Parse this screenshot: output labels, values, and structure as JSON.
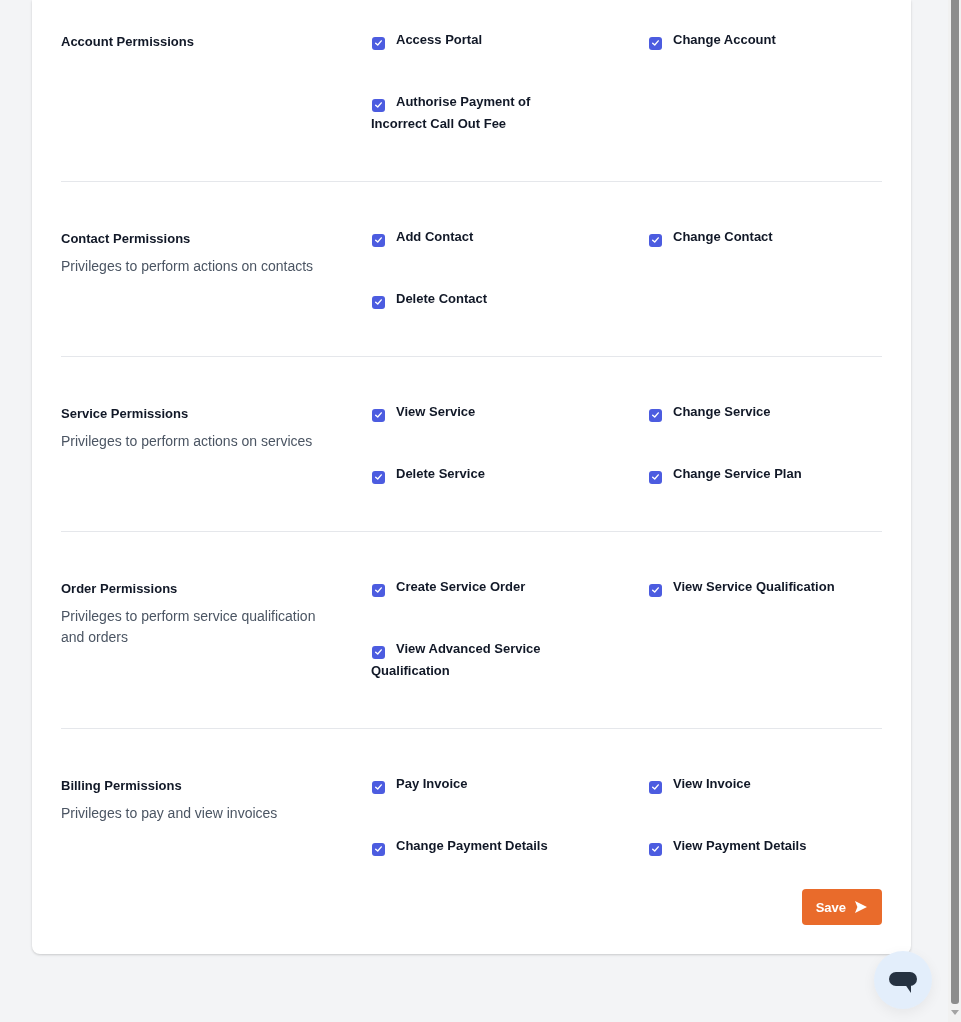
{
  "sections": [
    {
      "title": "Account Permissions",
      "permissions": [
        {
          "label": "Access Portal",
          "checked": true
        },
        {
          "label": "Change Account",
          "checked": true
        },
        {
          "label": "Authorise Payment of Incorrect Call Out Fee",
          "checked": true
        }
      ]
    },
    {
      "title": "Contact Permissions",
      "description": "Privileges to perform actions on contacts",
      "permissions": [
        {
          "label": "Add Contact",
          "checked": true
        },
        {
          "label": "Change Contact",
          "checked": true
        },
        {
          "label": "Delete Contact",
          "checked": true
        }
      ]
    },
    {
      "title": "Service Permissions",
      "description": "Privileges to perform actions on services",
      "permissions": [
        {
          "label": "View Service",
          "checked": true
        },
        {
          "label": "Change Service",
          "checked": true
        },
        {
          "label": "Delete Service",
          "checked": true
        },
        {
          "label": "Change Service Plan",
          "checked": true
        }
      ]
    },
    {
      "title": "Order Permissions",
      "description": "Privileges to perform service qualification and orders",
      "permissions": [
        {
          "label": "Create Service Order",
          "checked": true
        },
        {
          "label": "View Service Qualification",
          "checked": true
        },
        {
          "label": "View Advanced Service Qualification",
          "checked": true
        }
      ]
    },
    {
      "title": "Billing Permissions",
      "description": "Privileges to pay and view invoices",
      "permissions": [
        {
          "label": "Pay Invoice",
          "checked": true
        },
        {
          "label": "View Invoice",
          "checked": true
        },
        {
          "label": "Change Payment Details",
          "checked": true
        },
        {
          "label": "View Payment Details",
          "checked": true
        }
      ]
    }
  ],
  "save_button": {
    "label": "Save"
  }
}
